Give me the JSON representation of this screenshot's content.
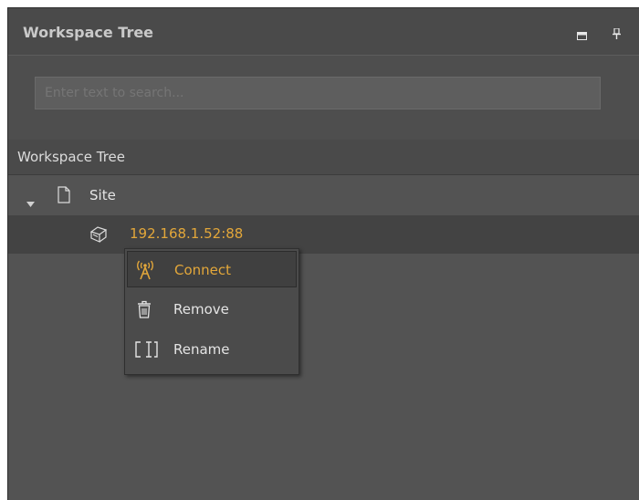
{
  "panel": {
    "title": "Workspace Tree",
    "icons": [
      "restore-icon",
      "pin-icon"
    ]
  },
  "search": {
    "placeholder": "Enter text to search..."
  },
  "section": {
    "label": "Workspace Tree"
  },
  "tree": {
    "site": {
      "label": "Site",
      "icon": "document-icon",
      "expanded": true
    },
    "server": {
      "label": "192.168.1.52:88",
      "icon": "server-icon"
    }
  },
  "context_menu": {
    "items": [
      {
        "label": "Connect",
        "icon": "antenna-icon",
        "active": true
      },
      {
        "label": "Remove",
        "icon": "trash-icon",
        "active": false
      },
      {
        "label": "Rename",
        "icon": "rename-icon",
        "active": false
      }
    ]
  },
  "colors": {
    "accent": "#e3a73a",
    "panel_bg": "#535353",
    "text": "#dcdcdc"
  }
}
